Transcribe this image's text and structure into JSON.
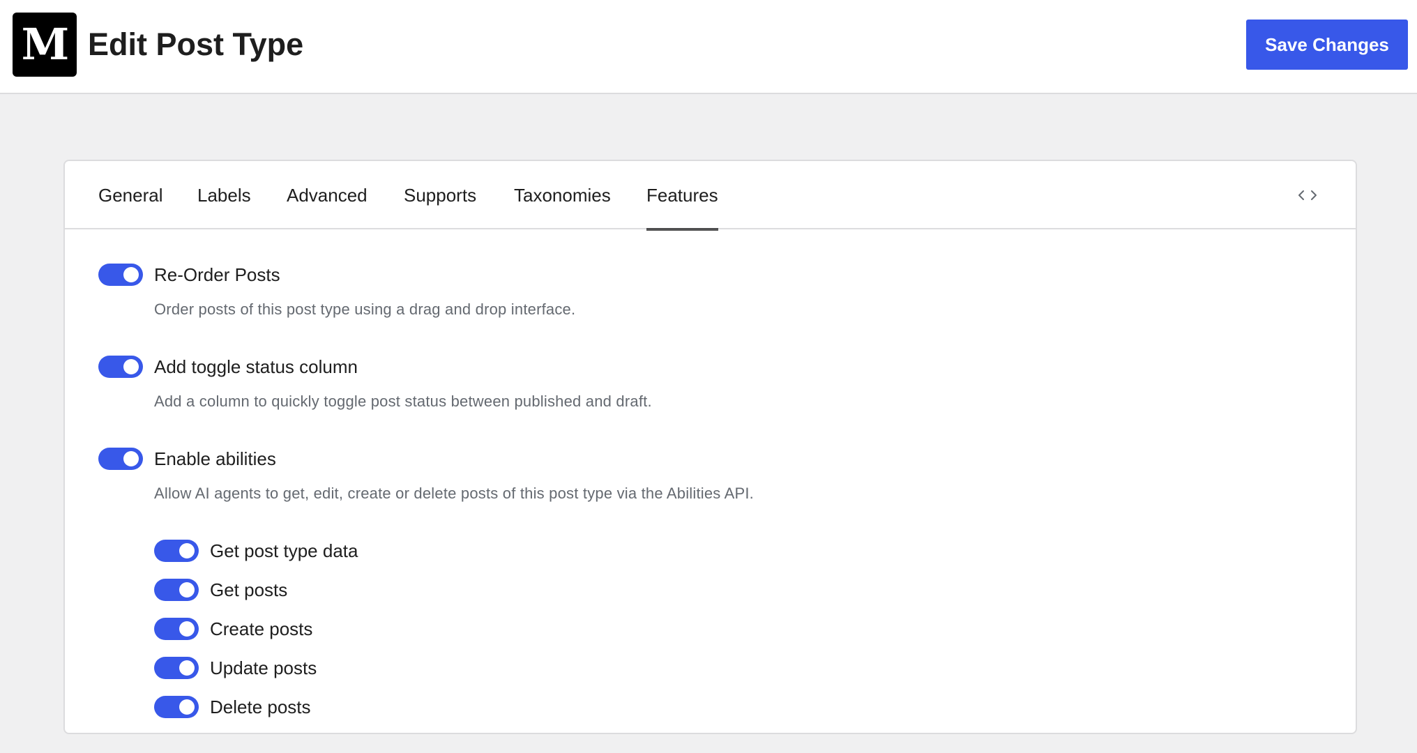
{
  "header": {
    "logo_letter": "M",
    "title": "Edit Post Type",
    "save_label": "Save Changes"
  },
  "tabs": [
    {
      "label": "General",
      "active": false
    },
    {
      "label": "Labels",
      "active": false
    },
    {
      "label": "Advanced",
      "active": false
    },
    {
      "label": "Supports",
      "active": false
    },
    {
      "label": "Taxonomies",
      "active": false
    },
    {
      "label": "Features",
      "active": true
    }
  ],
  "code_toggle_icon": "code-brackets-icon",
  "features": [
    {
      "label": "Re-Order Posts",
      "description": "Order posts of this post type using a drag and drop interface.",
      "enabled": true
    },
    {
      "label": "Add toggle status column",
      "description": "Add a column to quickly toggle post status between published and draft.",
      "enabled": true
    },
    {
      "label": "Enable abilities",
      "description": "Allow AI agents to get, edit, create or delete posts of this post type via the Abilities API.",
      "enabled": true
    }
  ],
  "abilities": [
    {
      "label": "Get post type data",
      "enabled": true
    },
    {
      "label": "Get posts",
      "enabled": true
    },
    {
      "label": "Create posts",
      "enabled": true
    },
    {
      "label": "Update posts",
      "enabled": true
    },
    {
      "label": "Delete posts",
      "enabled": true
    }
  ],
  "colors": {
    "accent": "#3858e9",
    "background": "#f0f0f1",
    "text": "#1e1e1e",
    "muted_text": "#646970"
  }
}
